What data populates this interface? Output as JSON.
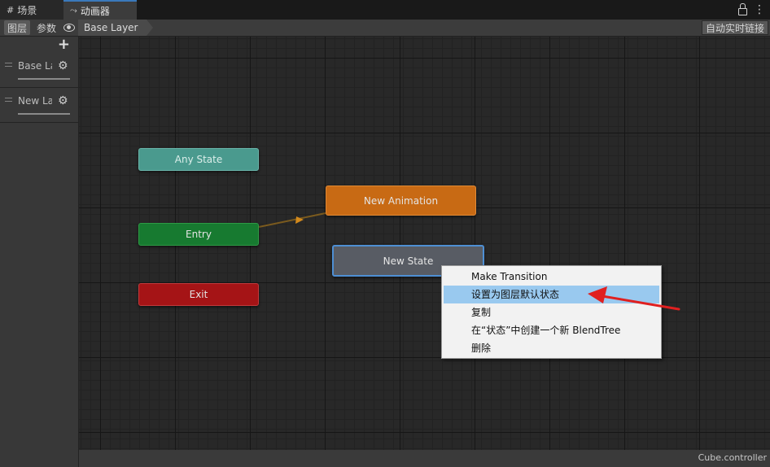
{
  "tabs": [
    {
      "icon": "#",
      "label": "场景"
    },
    {
      "icon": "⤳",
      "label": "动画器"
    }
  ],
  "toolbar": {
    "layers_label": "图层",
    "params_label": "参数",
    "breadcrumb": "Base Layer",
    "auto_live_link": "自动实时链接"
  },
  "sidebar": {
    "layers": [
      {
        "name": "Base Layer"
      },
      {
        "name": "New Layer"
      }
    ]
  },
  "graph": {
    "nodes": {
      "any_state": "Any State",
      "entry": "Entry",
      "exit": "Exit",
      "new_animation": "New Animation",
      "new_state": "New State"
    }
  },
  "context_menu": {
    "items": [
      {
        "label": "Make Transition"
      },
      {
        "label": "设置为图层默认状态"
      },
      {
        "label": "复制"
      },
      {
        "label": "在“状态”中创建一个新 BlendTree"
      },
      {
        "label": "删除"
      }
    ]
  },
  "status": {
    "file": "Cube.controller"
  },
  "colors": {
    "any_state": "#4a9a8e",
    "entry": "#177a30",
    "exit": "#a51416",
    "default_state": "#c86a14",
    "state": "#585c64",
    "selection": "#4e8fd4",
    "menu_highlight": "#99c9ef",
    "annotation_arrow": "#e02020"
  }
}
